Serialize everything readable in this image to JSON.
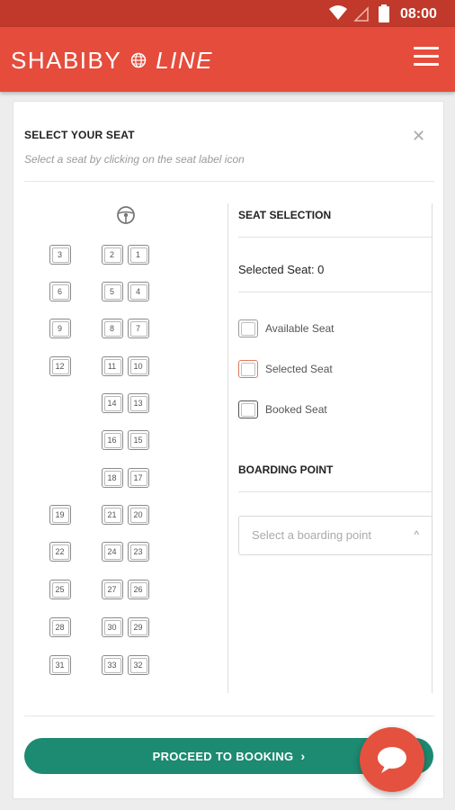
{
  "status_bar": {
    "time": "08:00"
  },
  "header": {
    "brand_left": "SHABIBY",
    "brand_right": "LINE"
  },
  "seat_panel": {
    "title": "SELECT YOUR SEAT",
    "subtitle": "Select a seat by clicking on the seat label icon"
  },
  "seats": [
    "3",
    "2",
    "1",
    "6",
    "5",
    "4",
    "9",
    "8",
    "7",
    "12",
    "11",
    "10",
    "14",
    "13",
    "16",
    "15",
    "18",
    "17",
    "19",
    "21",
    "20",
    "22",
    "24",
    "23",
    "25",
    "27",
    "26",
    "28",
    "30",
    "29",
    "31",
    "33",
    "32"
  ],
  "seat_selection": {
    "heading": "SEAT SELECTION",
    "selected_text": "Selected Seat: 0",
    "legend": {
      "available": "Available Seat",
      "selected": "Selected Seat",
      "booked": "Booked Seat"
    }
  },
  "boarding": {
    "heading": "BOARDING POINT",
    "placeholder": "Select a boarding point"
  },
  "proceed_label": "PROCEED TO BOOKING",
  "colors": {
    "status_bar": "#c0392b",
    "app_bar": "#e54c3c",
    "primary_button": "#1d8a72",
    "chat_fab": "#e5513f"
  }
}
